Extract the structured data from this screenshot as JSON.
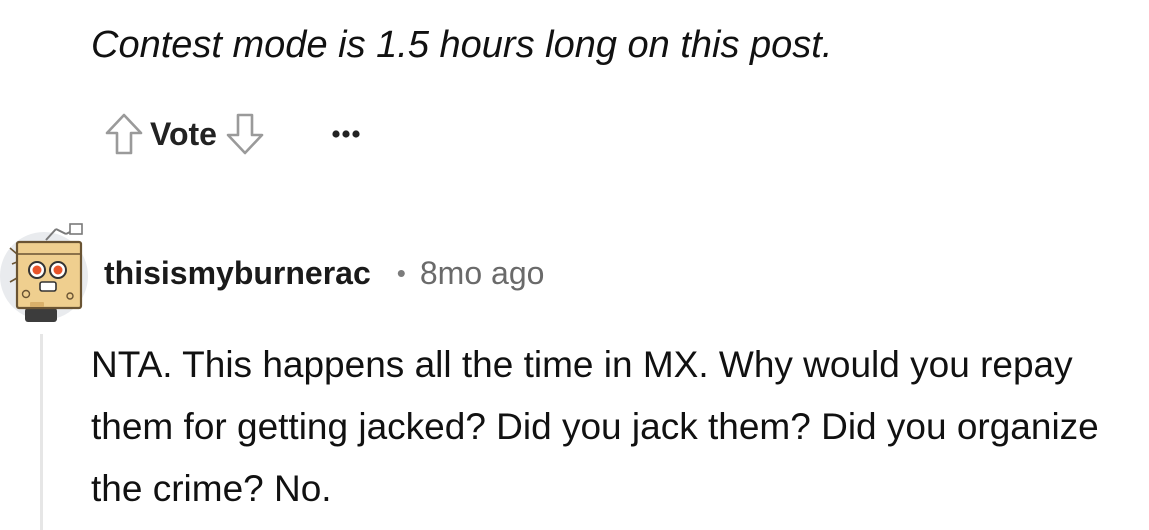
{
  "post": {
    "contest_note": "Contest mode is 1.5 hours long on this post."
  },
  "vote_bar": {
    "upvote_icon": "arrow-up-outline-icon",
    "label": "Vote",
    "downvote_icon": "arrow-down-outline-icon",
    "more_icon": "more-dots-icon",
    "icon_color": "#9a9a9a"
  },
  "comment": {
    "avatar_icon": "snoo-avatar-icon",
    "username": "thisismyburnerac",
    "separator": "•",
    "time_ago": "8mo ago",
    "body": "NTA. This happens all the time in MX. Why would you repay them for getting jacked? Did you jack them? Did you organize the crime? No."
  }
}
